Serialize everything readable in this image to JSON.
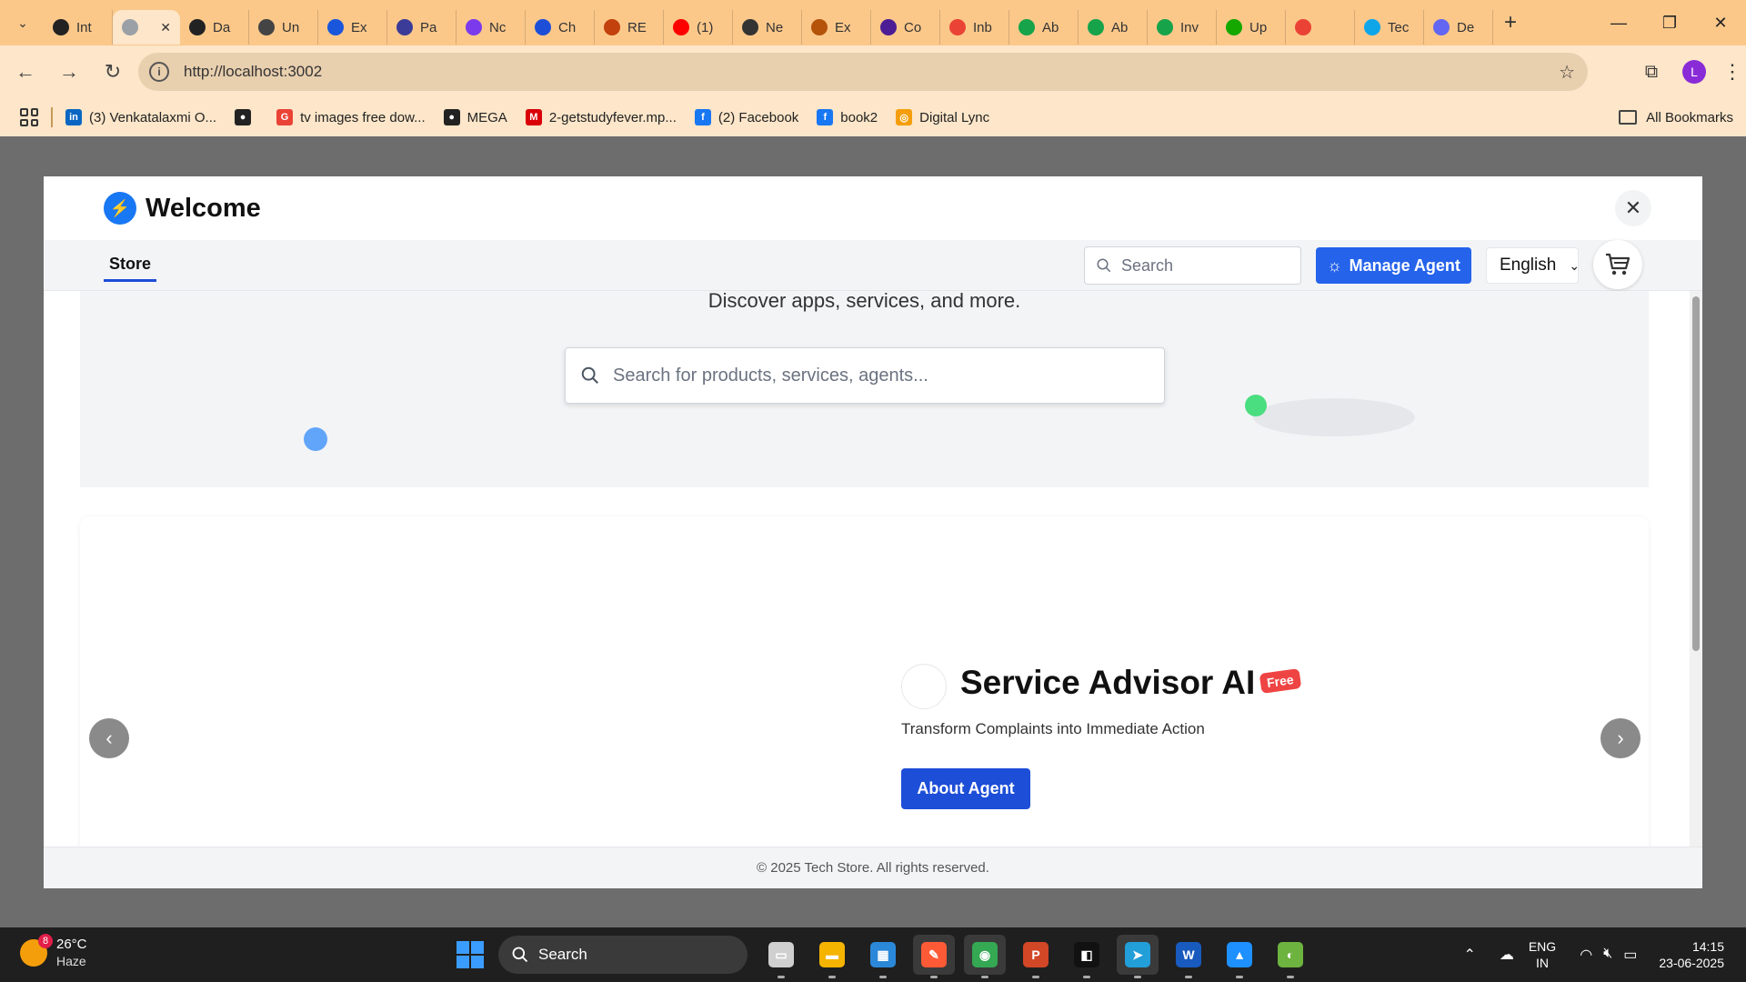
{
  "browser": {
    "tabs": [
      {
        "label": "Int",
        "color": "#222222"
      },
      {
        "label": "",
        "color": "#9aa0a6",
        "active": true
      },
      {
        "label": "Da",
        "color": "#222222"
      },
      {
        "label": "Un",
        "color": "#444444"
      },
      {
        "label": "Ex",
        "color": "#1a56db"
      },
      {
        "label": "Pa",
        "color": "#3b3b98"
      },
      {
        "label": "Nc",
        "color": "#7c3aed"
      },
      {
        "label": "Ch",
        "color": "#1d4ed8"
      },
      {
        "label": "RE",
        "color": "#c2410c"
      },
      {
        "label": "(1)",
        "color": "#ff0000"
      },
      {
        "label": "Ne",
        "color": "#333333"
      },
      {
        "label": "Ex",
        "color": "#b45309"
      },
      {
        "label": "Co",
        "color": "#4c1d95"
      },
      {
        "label": "Inb",
        "color": "#ea4335"
      },
      {
        "label": "Ab",
        "color": "#16a34a"
      },
      {
        "label": "Ab",
        "color": "#16a34a"
      },
      {
        "label": "Inv",
        "color": "#16a34a"
      },
      {
        "label": "Up",
        "color": "#14a800"
      },
      {
        "label": "",
        "color": "#ea4335"
      },
      {
        "label": "Tec",
        "color": "#0ea5e9"
      },
      {
        "label": "De",
        "color": "#6366f1"
      }
    ],
    "active_tab_close": "✕",
    "new_tab": "+",
    "window_controls": [
      "—",
      "❐",
      "✕"
    ],
    "url": "http://localhost:3002",
    "profile_initial": "L",
    "bookmarks": [
      {
        "label": "(3) Venkatalaxmi O...",
        "color": "#0a66c2",
        "glyph": "in"
      },
      {
        "label": "",
        "color": "#222222",
        "glyph": "●"
      },
      {
        "label": "tv images free dow...",
        "color": "#ea4335",
        "glyph": "G"
      },
      {
        "label": "MEGA",
        "color": "#222222",
        "glyph": "●"
      },
      {
        "label": "2-getstudyfever.mp...",
        "color": "#d90007",
        "glyph": "M"
      },
      {
        "label": "(2) Facebook",
        "color": "#1877f2",
        "glyph": "f"
      },
      {
        "label": "book2",
        "color": "#1877f2",
        "glyph": "f"
      },
      {
        "label": "Digital Lync",
        "color": "#f59e0b",
        "glyph": "◎"
      }
    ],
    "all_bookmarks": "All Bookmarks"
  },
  "modal": {
    "title": "Welcome",
    "close_label": "✕",
    "nav": {
      "store_tab": "Store",
      "search_placeholder": "Search",
      "manage_agent": "Manage Agent",
      "language": "English"
    },
    "hero": {
      "subtitle": "Discover apps, services, and more.",
      "search_placeholder": "Search for products, services, agents..."
    },
    "carousel": {
      "agent_name": "Service Advisor AI",
      "badge": "Free",
      "description": "Transform Complaints into Immediate Action",
      "cta": "About Agent",
      "prev": "‹",
      "next": "›"
    },
    "footer": "© 2025 Tech Store. All rights reserved."
  },
  "taskbar": {
    "weather_badge": "8",
    "temperature": "26°C",
    "condition": "Haze",
    "search_label": "Search",
    "apps": [
      {
        "name": "task-view",
        "color": "#cfcfcf",
        "glyph": "▭"
      },
      {
        "name": "file-explorer",
        "color": "#f5b400",
        "glyph": "▬"
      },
      {
        "name": "microsoft-store",
        "color": "#2b88d8",
        "glyph": "▦"
      },
      {
        "name": "pen-app",
        "color": "#ff5a36",
        "glyph": "✎",
        "active": true
      },
      {
        "name": "chrome",
        "color": "#34a853",
        "glyph": "◉",
        "active": true
      },
      {
        "name": "powerpoint",
        "color": "#d24726",
        "glyph": "P"
      },
      {
        "name": "capcut",
        "color": "#111111",
        "glyph": "◧"
      },
      {
        "name": "telegram",
        "color": "#229ed9",
        "glyph": "➤",
        "active": true
      },
      {
        "name": "word",
        "color": "#185abd",
        "glyph": "W"
      },
      {
        "name": "photos",
        "color": "#1e90ff",
        "glyph": "▲"
      },
      {
        "name": "spring-tool",
        "color": "#6db33f",
        "glyph": "◐"
      }
    ],
    "lang_top": "ENG",
    "lang_bottom": "IN",
    "time": "14:15",
    "date": "23-06-2025"
  }
}
